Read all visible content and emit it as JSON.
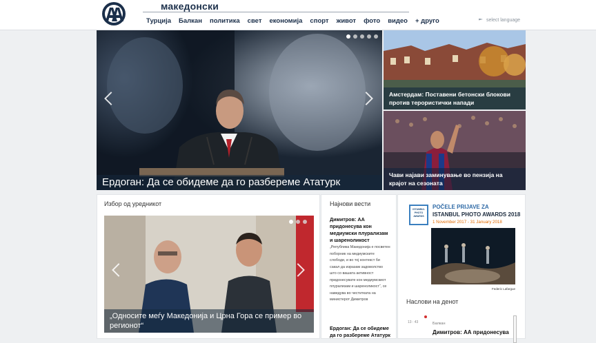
{
  "header": {
    "language_title": "македонски",
    "select_language": "select language",
    "nav": [
      "Турција",
      "Балкан",
      "политика",
      "свет",
      "економија",
      "спорт",
      "живот",
      "фото",
      "видео",
      "+ друго"
    ]
  },
  "hero": {
    "caption": "Ердоган: Да се обидеме да го разбереме Ататурк",
    "slide_count": 5,
    "active_slide": 1
  },
  "side_stories": [
    {
      "caption": "Амстердам: Поставени бетонски блокови против терористички напади"
    },
    {
      "caption": "Чави најави заминување во пензија на крајот на сезоната"
    }
  ],
  "editor": {
    "title": "Избор од уредникот",
    "caption": "„Односите меѓу Македонија и Црна Гора се пример во регионот“",
    "slide_count": 3,
    "active_slide": 1
  },
  "latest": {
    "title": "Најнови вести",
    "item1_headline": "Димитров: АА придонесува кон медиумски плурализам и шареноликост",
    "item1_body": "„Република Македонија е посветен поборник на медиумските слободи, и во тој контекст би сакал да изразам задоволство што со вашата активност придонесувате кон медиумскиот плурализам и шареноликост“, се наведува во честитката на министерот Димитров",
    "item2_headline": "Ердоган: Да се обидеме да го разбереме Ататурк"
  },
  "ad": {
    "logo_text": "ISTANBUL PHOTO AWARDS by Anadolu Agency",
    "line1": "POČELE PRIJAVE ZA",
    "line2": "ISTANBUL PHOTO AWARDS 2018",
    "line3": "1 November 2017 - 31 January 2018",
    "credit": "Federic Lafargue"
  },
  "headlines_of_day": {
    "title": "Наслови на денот",
    "time": "13 : 43",
    "category": "Балкан",
    "headline": "Димитров: АА придонесува"
  },
  "colors": {
    "brand": "#1b2f4a",
    "caption_overlay": "#14283c",
    "ad_blue": "#2f6aa6",
    "ad_orange": "#e06a00"
  }
}
